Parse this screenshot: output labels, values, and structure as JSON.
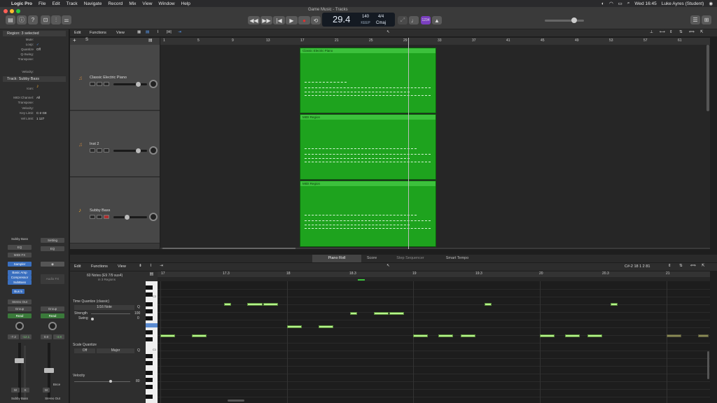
{
  "menubar": {
    "app": "Logic Pro",
    "items": [
      "File",
      "Edit",
      "Track",
      "Navigate",
      "Record",
      "Mix",
      "View",
      "Window",
      "Help"
    ],
    "clock": "Wed 16:45",
    "user": "Luke Ayres (Student)"
  },
  "window": {
    "title": "Game Music - Tracks"
  },
  "lcd": {
    "position": "29.4",
    "tempo": "140",
    "tempo_label": "KEEP",
    "signature": "4/4",
    "key": "Cmaj"
  },
  "toolbar": {
    "count_in": "1234"
  },
  "inspector": {
    "region_header": "Region: 3 selected",
    "region_rows": [
      {
        "k": "Mute:",
        "v": ""
      },
      {
        "k": "Loop:",
        "v": "✓"
      },
      {
        "k": "Quantize",
        "v": "Off"
      },
      {
        "k": "Q-Swing:",
        "v": ""
      },
      {
        "k": "Transpose:",
        "v": ""
      },
      {
        "k": "Velocity:",
        "v": ""
      }
    ],
    "track_header": "Track:  Subby Bass",
    "track_rows": [
      {
        "k": "Icon:",
        "v": ""
      },
      {
        "k": "MIDI Channel:",
        "v": "All"
      },
      {
        "k": "Transpose:",
        "v": ""
      },
      {
        "k": "Velocity:",
        "v": ""
      },
      {
        "k": "Key Limit:",
        "v": "C-2  G8"
      },
      {
        "k": "Vel Limit:",
        "v": "1  127"
      }
    ]
  },
  "strip1": {
    "name": "Subby Bass",
    "eq": "EQ",
    "midi_fx": "MIDI FX",
    "instrument": "Sampler",
    "fx": [
      "Basic Amp",
      "Compressor",
      "SubBass"
    ],
    "send": "Bus 5",
    "output": "Stereo Out",
    "group": "Group",
    "automation": "Read",
    "vol": "-7.2",
    "peak": "-12.1",
    "mute": "M",
    "solo": "S"
  },
  "strip2": {
    "name": "Stereo Out",
    "setting": "Setting",
    "eq": "EQ",
    "audio_fx": "Audio FX",
    "group": "Group",
    "automation": "Read",
    "vol": "0.0",
    "peak": "-4.8",
    "mute": "M",
    "bounce": "Bnce"
  },
  "tracks_toolbar": {
    "edit": "Edit",
    "functions": "Functions",
    "view": "View"
  },
  "tracks": [
    {
      "name": "Classic Electric Piano",
      "region": "Classic Electric Piano"
    },
    {
      "name": "Inst 2",
      "region": "MIDI Region"
    },
    {
      "name": "Subby Bass",
      "region": "MIDI Region"
    }
  ],
  "ruler_bars": [
    "1",
    "5",
    "9",
    "13",
    "17",
    "21",
    "25",
    "29",
    "33",
    "37",
    "41",
    "45",
    "49",
    "53",
    "57",
    "61"
  ],
  "editor_tabs": [
    "Piano Roll",
    "Score",
    "Step Sequencer",
    "Smart Tempo"
  ],
  "editor": {
    "edit": "Edit",
    "functions": "Functions",
    "view": "View",
    "note_info": "60 Notes (E9 7/9 sus4)",
    "note_info2": "in 3 Regions",
    "time_quantize": "Time Quantize (classic)",
    "note_value": "1/16 Note",
    "strength_label": "Strength",
    "strength": "100",
    "swing_label": "Swing",
    "swing": "0",
    "scale_quantize": "Scale Quantize",
    "scale_off": "Off",
    "scale_type": "Major",
    "velocity_label": "Velocity",
    "velocity": "80",
    "position": "C#-2   18 1 2 81"
  },
  "pr_ruler": [
    "17",
    "17.3",
    "18",
    "18.3",
    "19",
    "19.3",
    "20",
    "20.3",
    "21"
  ],
  "keys": {
    "c2": "C2",
    "c1": "C1"
  }
}
